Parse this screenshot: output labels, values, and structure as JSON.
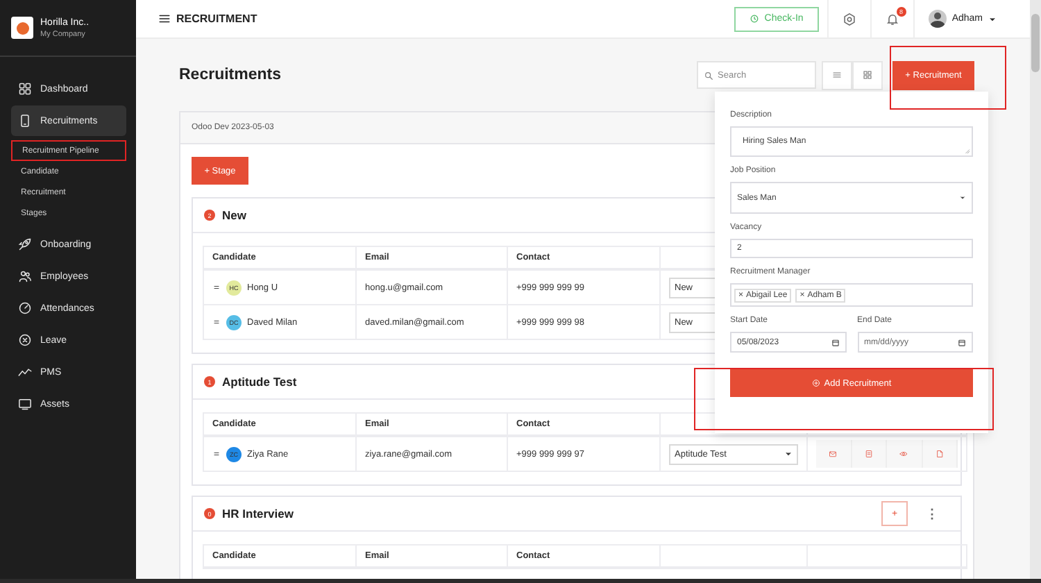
{
  "company": {
    "name": "Horilla Inc..",
    "subtitle": "My Company"
  },
  "sidebar": {
    "items": [
      {
        "label": "Dashboard",
        "selected": false
      },
      {
        "label": "Recruitments",
        "selected": true,
        "expanded": true,
        "children": [
          {
            "label": "Recruitment Pipeline",
            "highlighted": true
          },
          {
            "label": "Candidate",
            "highlighted": false
          },
          {
            "label": "Recruitment",
            "highlighted": false
          },
          {
            "label": "Stages",
            "highlighted": false
          }
        ]
      },
      {
        "label": "Onboarding",
        "selected": false
      },
      {
        "label": "Employees",
        "selected": false
      },
      {
        "label": "Attendances",
        "selected": false
      },
      {
        "label": "Leave",
        "selected": false
      },
      {
        "label": "PMS",
        "selected": false
      },
      {
        "label": "Assets",
        "selected": false
      }
    ]
  },
  "topbar": {
    "title": "RECRUITMENT",
    "check_in": "Check-In",
    "notification_count": "8",
    "user": "Adham"
  },
  "page": {
    "title": "Recruitments",
    "search": {
      "placeholder": "Search"
    },
    "add_button": {
      "label": "+ Recruitment",
      "highlighted": true
    }
  },
  "recruitment": {
    "title": "Odoo Dev 2023-05-03",
    "stage_button": "+ Stage",
    "stages": [
      {
        "name": "New",
        "count": "2",
        "columns": [
          "Candidate",
          "Email",
          "Contact"
        ],
        "rows": [
          {
            "kind": "basic",
            "initials": "HC",
            "color": "#e2ea9c",
            "candidate": "Hong U",
            "email": "hong.u@gmail.com",
            "contact": "+999 999 999 99",
            "stage": "New"
          },
          {
            "kind": "basic",
            "initials": "DC",
            "color": "#56bde6",
            "candidate": "Daved Milan",
            "email": "daved.milan@gmail.com",
            "contact": "+999 999 999 98",
            "stage": "New"
          }
        ]
      },
      {
        "name": "Aptitude Test",
        "count": "1",
        "columns": [
          "Candidate",
          "Email",
          "Contact"
        ],
        "rows": [
          {
            "kind": "full",
            "initials": "ZC",
            "color": "#1e88e5",
            "candidate": "Ziya Rane",
            "email": "ziya.rane@gmail.com",
            "contact": "+999 999 999 97",
            "stage": "Aptitude Test"
          }
        ]
      },
      {
        "name": "HR Interview",
        "count": "0",
        "add_button": "+",
        "menu_button": "⋮",
        "columns": [
          "Candidate",
          "Email",
          "Contact"
        ]
      }
    ]
  },
  "popup": {
    "fields": [
      {
        "kind": "textarea",
        "label": "Description",
        "value": "Hiring Sales Man"
      },
      {
        "kind": "select",
        "label": "Job Position",
        "value": "Sales Man"
      },
      {
        "kind": "text",
        "label": "Vacancy",
        "value": "2"
      },
      {
        "kind": "tags",
        "label": "Recruitment Manager",
        "tags": [
          {
            "remove": "×",
            "label": "Abigail Lee"
          },
          {
            "remove": "×",
            "label": "Adham B"
          }
        ]
      },
      {
        "kind": "date",
        "label": "Start Date",
        "value": "05/08/2023"
      },
      {
        "kind": "date",
        "label": "End Date",
        "placeholder": "mm/dd/yyyy"
      }
    ],
    "submit": {
      "label": "Add Recruitment",
      "highlighted": true
    }
  }
}
